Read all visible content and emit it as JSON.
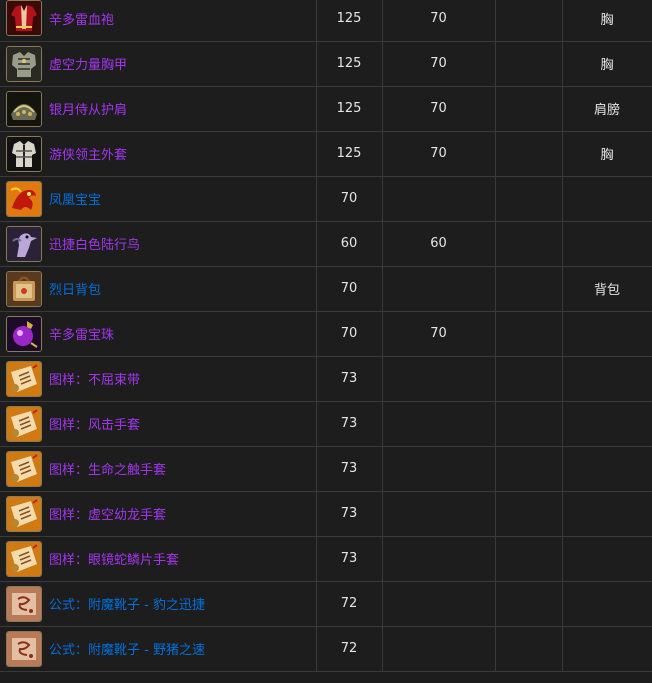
{
  "colors": {
    "epic": "#a335ee",
    "rare": "#0070dd",
    "text": "#e6e6e6",
    "background": "#1d1d1d",
    "grid": "#3a3a3a"
  },
  "rows": [
    {
      "icon": "red-robe-icon",
      "quality": "epic",
      "name": "辛多雷血袍",
      "c1": "125",
      "c2": "70",
      "c3": "",
      "c4": "胸"
    },
    {
      "icon": "gray-chestplate-icon",
      "quality": "epic",
      "name": "虚空力量胸甲",
      "c1": "125",
      "c2": "70",
      "c3": "",
      "c4": "胸"
    },
    {
      "icon": "shoulder-armor-icon",
      "quality": "epic",
      "name": "银月侍从护肩",
      "c1": "125",
      "c2": "70",
      "c3": "",
      "c4": "肩膀"
    },
    {
      "icon": "leather-vest-icon",
      "quality": "epic",
      "name": "游侠领主外套",
      "c1": "125",
      "c2": "70",
      "c3": "",
      "c4": "胸"
    },
    {
      "icon": "phoenix-icon",
      "quality": "rare",
      "name": "凤凰宝宝",
      "c1": "70",
      "c2": "",
      "c3": "",
      "c4": ""
    },
    {
      "icon": "hawkstrider-icon",
      "quality": "epic",
      "name": "迅捷白色陆行鸟",
      "c1": "60",
      "c2": "60",
      "c3": "",
      "c4": ""
    },
    {
      "icon": "bag-icon",
      "quality": "rare",
      "name": "烈日背包",
      "c1": "70",
      "c2": "",
      "c3": "",
      "c4": "背包"
    },
    {
      "icon": "purple-orb-icon",
      "quality": "epic",
      "name": "辛多雷宝珠",
      "c1": "70",
      "c2": "70",
      "c3": "",
      "c4": ""
    },
    {
      "icon": "pattern-scroll-icon",
      "quality": "epic",
      "name": "图样：不屈束带",
      "c1": "73",
      "c2": "",
      "c3": "",
      "c4": ""
    },
    {
      "icon": "pattern-scroll-icon",
      "quality": "epic",
      "name": "图样：风击手套",
      "c1": "73",
      "c2": "",
      "c3": "",
      "c4": ""
    },
    {
      "icon": "pattern-scroll-icon",
      "quality": "epic",
      "name": "图样：生命之触手套",
      "c1": "73",
      "c2": "",
      "c3": "",
      "c4": ""
    },
    {
      "icon": "pattern-scroll-icon",
      "quality": "epic",
      "name": "图样：虚空幼龙手套",
      "c1": "73",
      "c2": "",
      "c3": "",
      "c4": ""
    },
    {
      "icon": "pattern-scroll-icon",
      "quality": "epic",
      "name": "图样：眼镜蛇鳞片手套",
      "c1": "73",
      "c2": "",
      "c3": "",
      "c4": ""
    },
    {
      "icon": "formula-scroll-icon",
      "quality": "rare",
      "name": "公式：附魔靴子 - 豹之迅捷",
      "c1": "72",
      "c2": "",
      "c3": "",
      "c4": ""
    },
    {
      "icon": "formula-scroll-icon",
      "quality": "rare",
      "name": "公式：附魔靴子 - 野猪之速",
      "c1": "72",
      "c2": "",
      "c3": "",
      "c4": ""
    }
  ]
}
